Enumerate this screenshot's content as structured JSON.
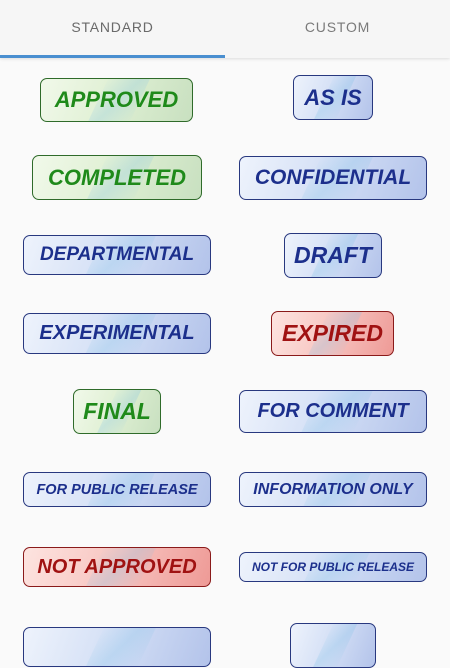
{
  "tabs": [
    {
      "label": "STANDARD",
      "active": true
    },
    {
      "label": "CUSTOM",
      "active": false
    }
  ],
  "stamps": {
    "approved": "APPROVED",
    "as_is": "AS IS",
    "completed": "COMPLETED",
    "confidential": "CONFIDENTIAL",
    "departmental": "DEPARTMENTAL",
    "draft": "DRAFT",
    "experimental": "EXPERIMENTAL",
    "expired": "EXPIRED",
    "final": "FINAL",
    "for_comment": "FOR COMMENT",
    "for_public_release": "FOR PUBLIC RELEASE",
    "information_only": "INFORMATION ONLY",
    "not_approved": "NOT APPROVED",
    "not_for_public_release": "NOT FOR PUBLIC RELEASE"
  },
  "colors": {
    "accent": "#4a8fd0",
    "stamp_green": "#1f8a1a",
    "stamp_blue": "#1c2f8c",
    "stamp_red": "#a01212"
  }
}
